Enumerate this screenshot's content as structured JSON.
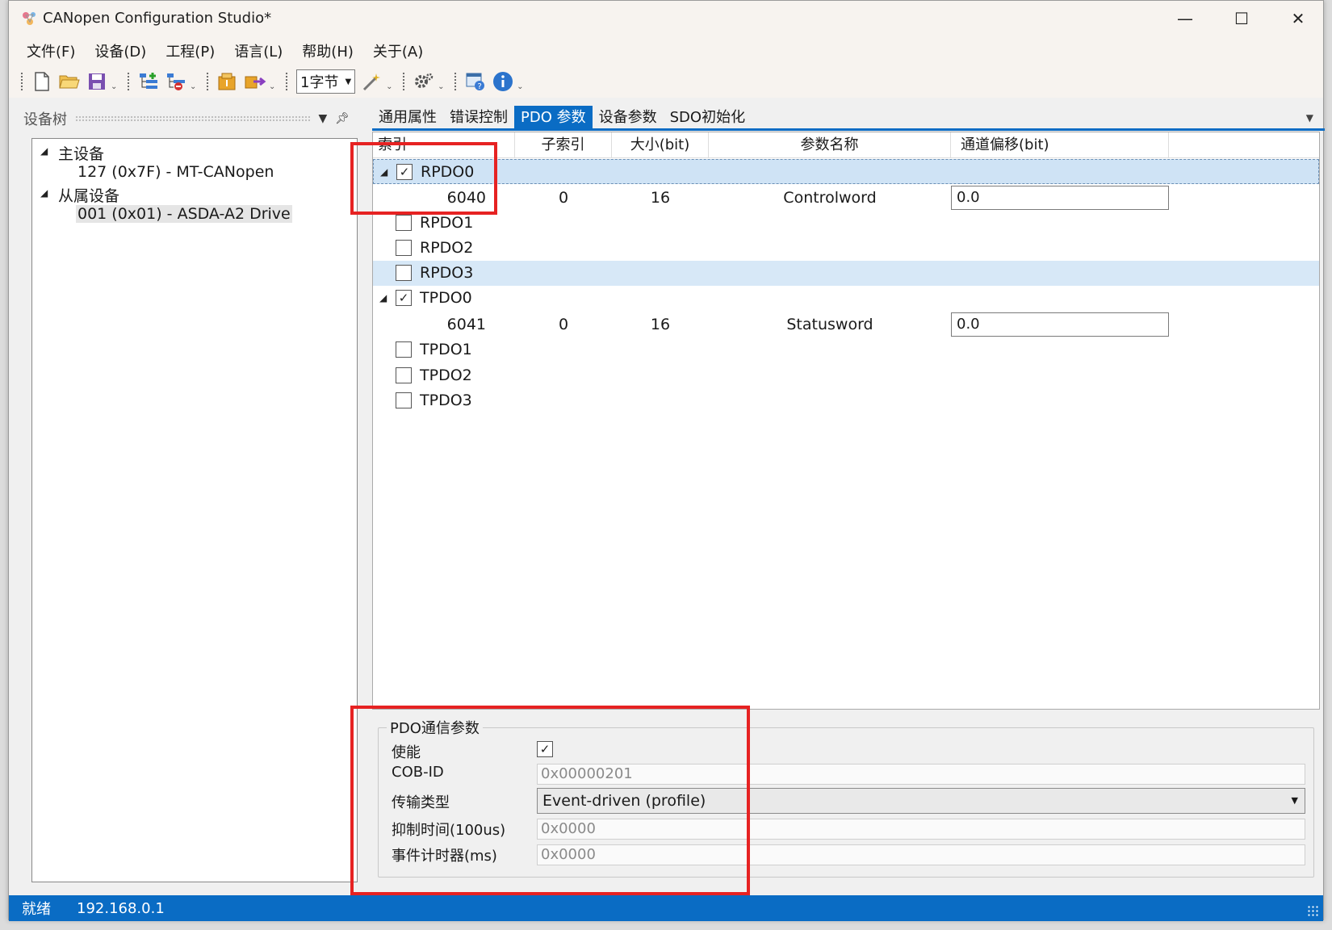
{
  "window": {
    "title": "CANopen Configuration Studio*",
    "minimize_glyph": "—",
    "maximize_glyph": "☐",
    "close_glyph": "✕"
  },
  "menu": [
    "文件(F)",
    "设备(D)",
    "工程(P)",
    "语言(L)",
    "帮助(H)",
    "关于(A)"
  ],
  "toolbar": {
    "byte_combo_value": "1字节",
    "icons": [
      "new-file-icon",
      "open-folder-icon",
      "save-icon",
      "add-device-icon",
      "remove-device-icon",
      "import-icon",
      "export-icon",
      "wizard-wand-icon",
      "settings-gear-icon",
      "help-window-icon",
      "info-icon"
    ]
  },
  "device_tree": {
    "header": "设备树",
    "master_label": "主设备",
    "master_device": "127 (0x7F)  -  MT-CANopen",
    "slave_label": "从属设备",
    "slave_device": "001 (0x01)  -  ASDA-A2 Drive"
  },
  "tabs": [
    "通用属性",
    "错误控制",
    "PDO 参数",
    "设备参数",
    "SDO初始化"
  ],
  "active_tab": "PDO 参数",
  "grid": {
    "columns": [
      "索引",
      "子索引",
      "大小(bit)",
      "参数名称",
      "通道偏移(bit)"
    ],
    "pdos": [
      {
        "name": "RPDO0",
        "checked": true,
        "expanded": true,
        "entry": {
          "index": "6040",
          "subindex": "0",
          "size": "16",
          "param": "Controlword",
          "offset": "0.0"
        }
      },
      {
        "name": "RPDO1",
        "checked": false
      },
      {
        "name": "RPDO2",
        "checked": false
      },
      {
        "name": "RPDO3",
        "checked": false
      },
      {
        "name": "TPDO0",
        "checked": true,
        "expanded": true,
        "entry": {
          "index": "6041",
          "subindex": "0",
          "size": "16",
          "param": "Statusword",
          "offset": "0.0"
        }
      },
      {
        "name": "TPDO1",
        "checked": false
      },
      {
        "name": "TPDO2",
        "checked": false
      },
      {
        "name": "TPDO3",
        "checked": false
      }
    ]
  },
  "pdo_comm": {
    "title": "PDO通信参数",
    "enable_label": "使能",
    "enable_checked": true,
    "cob_id_label": "COB-ID",
    "cob_id_value": "0x00000201",
    "transmission_label": "传输类型",
    "transmission_value": "Event-driven (profile)",
    "inhibit_label": "抑制时间(100us)",
    "inhibit_value": "0x0000",
    "event_timer_label": "事件计时器(ms)",
    "event_timer_value": "0x0000"
  },
  "status": {
    "state": "就绪",
    "ip": "192.168.0.1"
  },
  "colors": {
    "accent": "#0a6cc4",
    "annotation": "#e62222",
    "selection": "#cfe3f5"
  }
}
